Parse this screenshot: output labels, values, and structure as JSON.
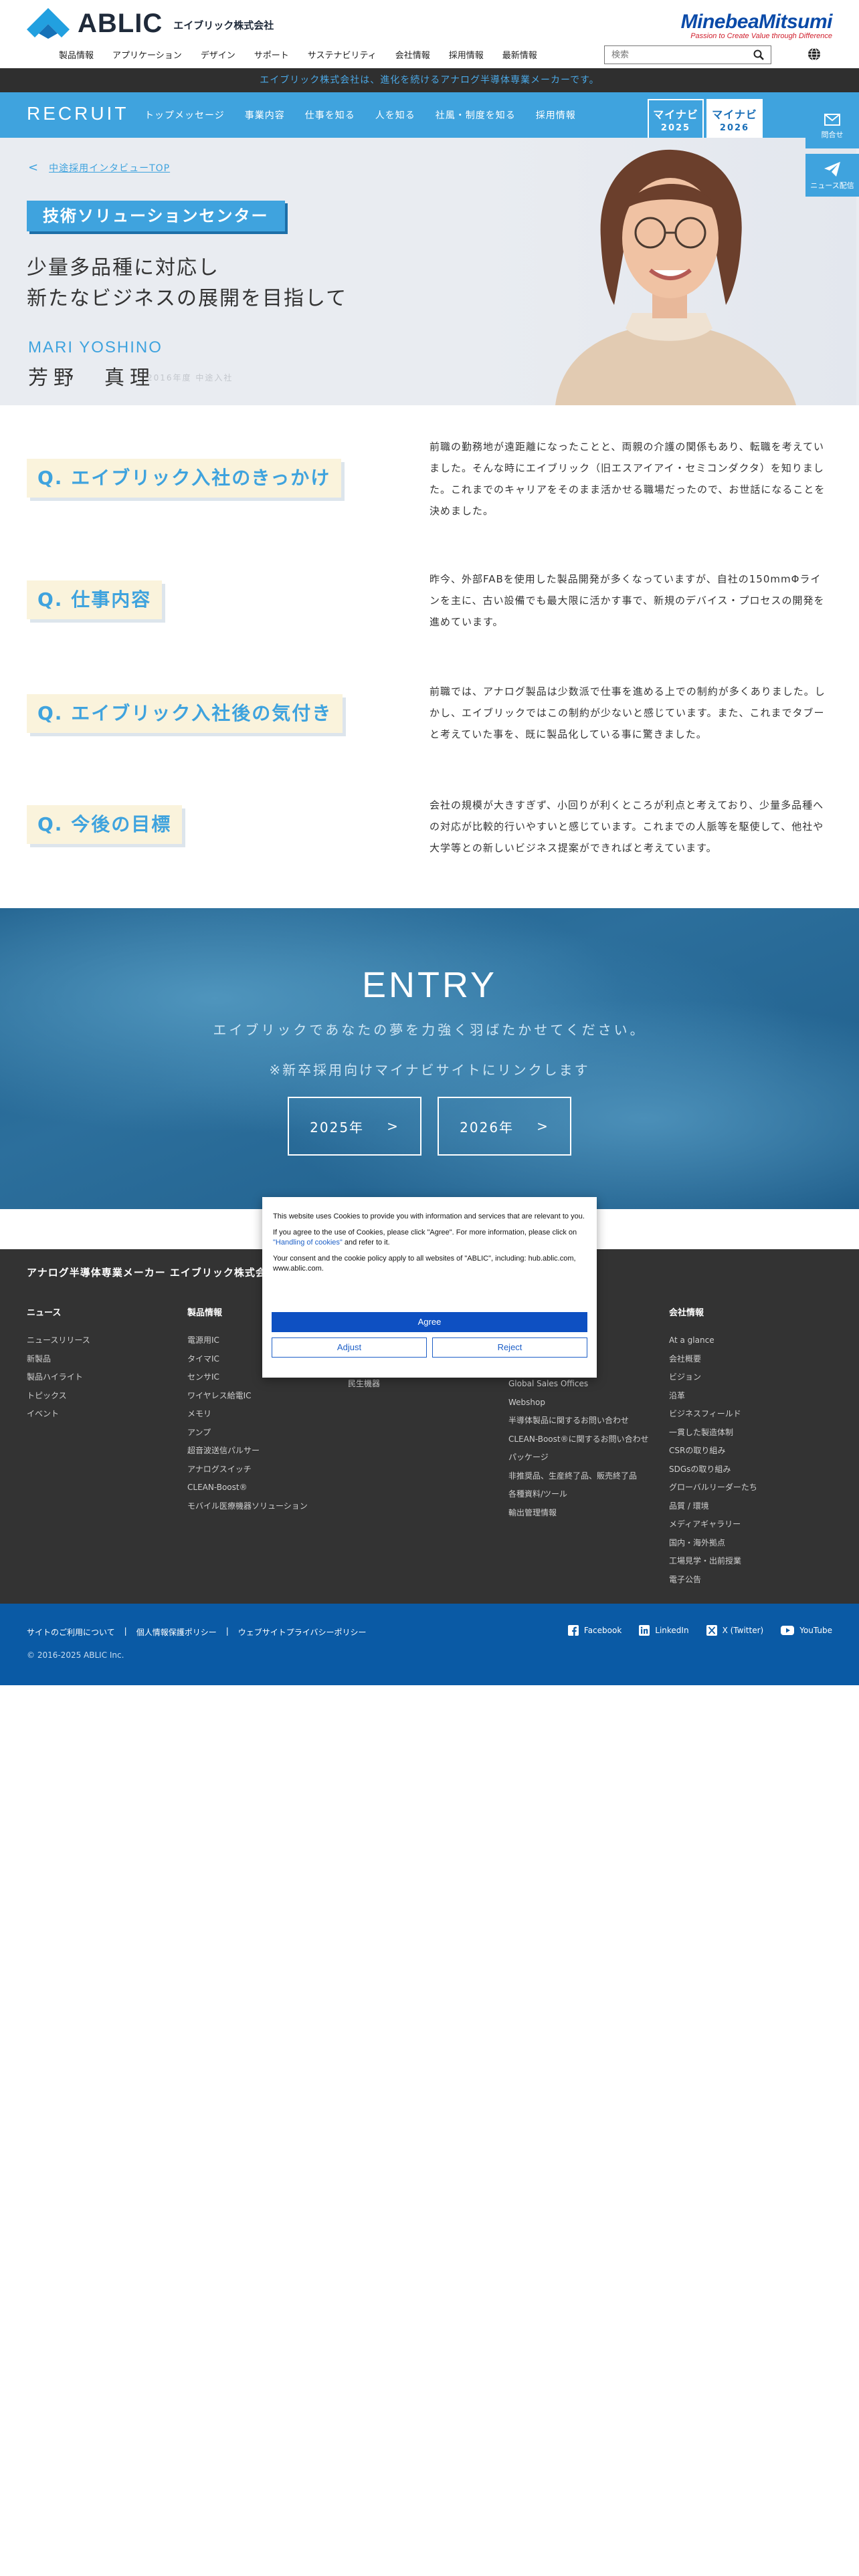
{
  "header": {
    "logo_text": "ABLIC",
    "logo_sub": "エイブリック株式会社",
    "partner_logo": "MinebeaMitsumi",
    "partner_tagline": "Passion to Create Value through Difference",
    "nav": [
      "製品情報",
      "アプリケーション",
      "デザイン",
      "サポート",
      "サステナビリティ",
      "会社情報",
      "採用情報",
      "最新情報"
    ],
    "search_placeholder": "検索",
    "icons": {
      "search": "search-icon",
      "language": "globe-icon"
    }
  },
  "notice": "エイブリック株式会社は、進化を続けるアナログ半導体専業メーカーです。",
  "recruit": {
    "title": "RECRUIT",
    "nav": [
      "トップメッセージ",
      "事業内容",
      "仕事を知る",
      "人を知る",
      "社風・制度を知る",
      "採用情報"
    ],
    "mynavi_2025": {
      "name": "マイナビ",
      "year": "2025"
    },
    "mynavi_2026": {
      "name": "マイナビ",
      "year": "2026"
    },
    "side_contact": "問合せ",
    "side_news": "ニュース配信"
  },
  "hero": {
    "breadcrumb": "中途採用インタビューTOP",
    "department": "技術ソリューションセンター",
    "catch_line1": "少量多品種に対応し",
    "catch_line2": "新たなビジネスの展開を目指して",
    "name_en": "MARI YOSHINO",
    "name_jp": "芳野　真理",
    "joined": "2016年度 中途入社"
  },
  "qa": [
    {
      "q": "Q. エイブリック入社のきっかけ",
      "a": "前職の勤務地が遠距離になったことと、両親の介護の関係もあり、転職を考えていました。そんな時にエイブリック（旧エスアイアイ・セミコンダクタ）を知りました。これまでのキャリアをそのまま活かせる職場だったので、お世話になることを決めました。"
    },
    {
      "q": "Q. 仕事内容",
      "a": "昨今、外部FABを使用した製品開発が多くなっていますが、自社の150mmΦラインを主に、古い設備でも最大限に活かす事で、新規のデバイス・プロセスの開発を進めています。"
    },
    {
      "q": "Q. エイブリック入社後の気付き",
      "a": "前職では、アナログ製品は少数派で仕事を進める上での制約が多くありました。しかし、エイブリックではこの制約が少ないと感じています。また、これまでタブーと考えていた事を、既に製品化している事に驚きました。"
    },
    {
      "q": "Q. 今後の目標",
      "a": "会社の規模が大きすぎず、小回りが利くところが利点と考えており、少量多品種への対応が比較的行いやすいと感じています。これまでの人脈等を駆使して、他社や大学等との新しいビジネス提案ができればと考えています。"
    }
  ],
  "entry": {
    "title": "ENTRY",
    "subtitle": "エイブリックであなたの夢を力強く羽ばたかせてください。",
    "note": "※新卒採用向けマイナビサイトにリンクします",
    "btn_2025": "2025年",
    "btn_2026": "2026年"
  },
  "footer": {
    "title": "アナログ半導体専業メーカー エイブリック株式会社",
    "columns": [
      {
        "heading": "ニュース",
        "items": [
          "ニュースリリース",
          "新製品",
          "製品ハイライト",
          "トピックス",
          "イベント"
        ]
      },
      {
        "heading": "製品情報",
        "items": [
          "電源用IC",
          "タイマIC",
          "センサIC",
          "ワイヤレス給電IC",
          "メモリ",
          "アンプ",
          "超音波送信パルサー",
          "アナログスイッチ",
          "CLEAN-Boost®",
          "モバイル医療機器ソリューション"
        ]
      },
      {
        "heading": "",
        "items": [
          "民生機器"
        ]
      },
      {
        "heading": "",
        "items": [
          "Global Sales Offices",
          "Webshop",
          "半導体製品に関するお問い合わせ",
          "CLEAN-Boost®に関するお問い合わせ",
          "パッケージ",
          "非推奨品、生産終了品、販売終了品",
          "各種資料/ツール",
          "輸出管理情報"
        ]
      },
      {
        "heading": "会社情報",
        "items": [
          "At a glance",
          "会社概要",
          "ビジョン",
          "沿革",
          "ビジネスフィールド",
          "一貫した製造体制",
          "CSRの取り組み",
          "SDGsの取り組み",
          "グローバルリーダーたち",
          "品質 / 環境",
          "メディアギャラリー",
          "国内・海外拠点",
          "工場見学・出前授業",
          "電子公告"
        ]
      }
    ],
    "legal": [
      "サイトのご利用について",
      "個人情報保護ポリシー",
      "ウェブサイトプライバシーポリシー"
    ],
    "copyright": "© 2016-2025 ABLIC Inc.",
    "social": [
      "Facebook",
      "LinkedIn",
      "X (Twitter)",
      "YouTube"
    ]
  },
  "cookie": {
    "p1": "This website uses Cookies to provide you with information and services that are relevant to you.",
    "p2a": "If you agree to the use of Cookies, please click \"Agree\". For more information, please click on ",
    "p2_link": "\"Handling of cookies\"",
    "p2b": " and refer to it.",
    "p3": "Your consent and the cookie policy apply to all websites of \"ABLIC\", including: hub.ablic.com, www.ablic.com.",
    "agree": "Agree",
    "adjust": "Adjust",
    "reject": "Reject"
  },
  "colors": {
    "brand_blue": "#3fa3de",
    "dark_bar": "#2f2f2f",
    "footer_bg": "#333333",
    "footer_bottom": "#0a5aa5",
    "question_bg": "#faf3dc"
  }
}
